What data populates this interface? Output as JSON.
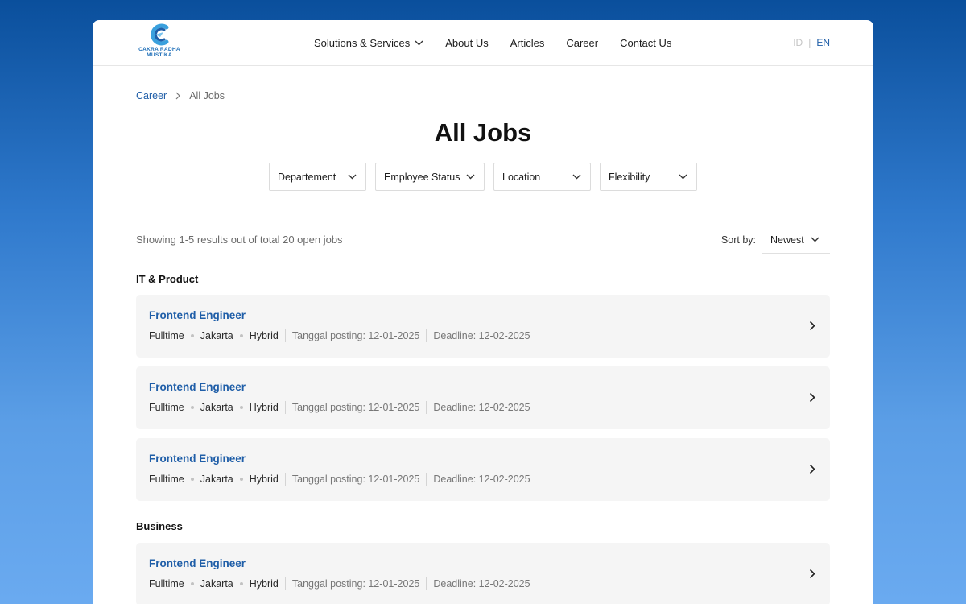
{
  "brand": {
    "logo_line1": "CAKRA RADHA",
    "logo_line2": "MUSTIKA",
    "accent": "#1f5ea8"
  },
  "nav": {
    "items": [
      {
        "label": "Solutions & Services",
        "has_dropdown": true
      },
      {
        "label": "About Us"
      },
      {
        "label": "Articles"
      },
      {
        "label": "Career"
      },
      {
        "label": "Contact Us"
      }
    ]
  },
  "language": {
    "id": "ID",
    "separator": "|",
    "en": "EN",
    "active": "EN"
  },
  "breadcrumb": {
    "parent": "Career",
    "current": "All Jobs"
  },
  "page": {
    "title": "All Jobs"
  },
  "filters": [
    {
      "label": "Departement"
    },
    {
      "label": "Employee Status"
    },
    {
      "label": "Location"
    },
    {
      "label": "Flexibility"
    }
  ],
  "results": {
    "summary": "Showing 1-5 results out of total 20 open jobs"
  },
  "sort": {
    "label": "Sort by:",
    "value": "Newest"
  },
  "sections": [
    {
      "title": "IT & Product",
      "jobs": [
        {
          "title": "Frontend Engineer",
          "type": "Fulltime",
          "location": "Jakarta",
          "flexibility": "Hybrid",
          "posted": "Tanggal posting: 12-01-2025",
          "deadline": "Deadline: 12-02-2025"
        },
        {
          "title": "Frontend Engineer",
          "type": "Fulltime",
          "location": "Jakarta",
          "flexibility": "Hybrid",
          "posted": "Tanggal posting: 12-01-2025",
          "deadline": "Deadline: 12-02-2025"
        },
        {
          "title": "Frontend Engineer",
          "type": "Fulltime",
          "location": "Jakarta",
          "flexibility": "Hybrid",
          "posted": "Tanggal posting: 12-01-2025",
          "deadline": "Deadline: 12-02-2025"
        }
      ]
    },
    {
      "title": "Business",
      "jobs": [
        {
          "title": "Frontend Engineer",
          "type": "Fulltime",
          "location": "Jakarta",
          "flexibility": "Hybrid",
          "posted": "Tanggal posting: 12-01-2025",
          "deadline": "Deadline: 12-02-2025"
        }
      ]
    }
  ],
  "icons": {
    "dropdown": "chevron-down-icon",
    "job_open": "chevron-right-icon",
    "breadcrumb_sep": "chevron-right-icon"
  }
}
